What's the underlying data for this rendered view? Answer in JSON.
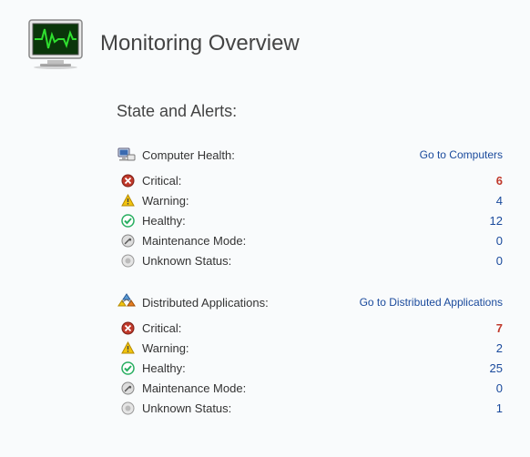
{
  "header": {
    "title": "Monitoring Overview"
  },
  "section_title": "State and Alerts:",
  "groups": {
    "computer_health": {
      "label": "Computer Health:",
      "link": "Go to Computers",
      "rows": {
        "critical": {
          "label": "Critical:",
          "value": "6"
        },
        "warning": {
          "label": "Warning:",
          "value": "4"
        },
        "healthy": {
          "label": "Healthy:",
          "value": "12"
        },
        "maintenance": {
          "label": "Maintenance Mode:",
          "value": "0"
        },
        "unknown": {
          "label": "Unknown Status:",
          "value": "0"
        }
      }
    },
    "distributed_apps": {
      "label": "Distributed Applications:",
      "link": "Go to Distributed Applications",
      "rows": {
        "critical": {
          "label": "Critical:",
          "value": "7"
        },
        "warning": {
          "label": "Warning:",
          "value": "2"
        },
        "healthy": {
          "label": "Healthy:",
          "value": "25"
        },
        "maintenance": {
          "label": "Maintenance Mode:",
          "value": "0"
        },
        "unknown": {
          "label": "Unknown Status:",
          "value": "1"
        }
      }
    }
  }
}
